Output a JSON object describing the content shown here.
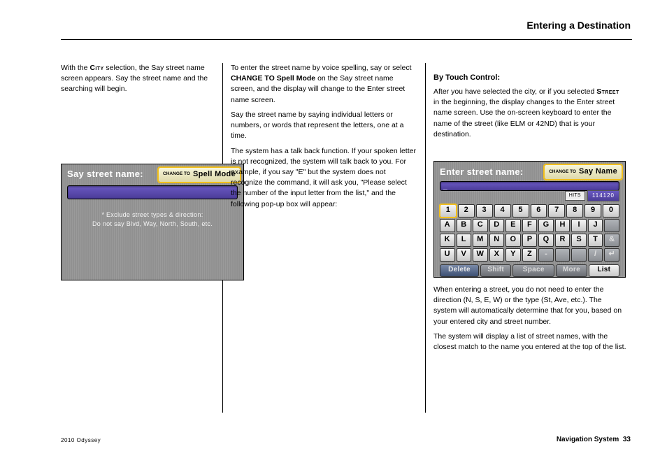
{
  "header": {
    "section_title": "Entering a Destination"
  },
  "col1": {
    "p1_a": "With the ",
    "p1_nav": "City",
    "p1_b": " selection, the Say street name screen appears. Say the street name and the searching will begin."
  },
  "screen1": {
    "title": "Say street name:",
    "change_pre": "CHANGE\nTO",
    "change_label": "Spell Mode",
    "helper1": "* Exclude street types & direction:",
    "helper2": "Do not say Blvd, Way, North, South, etc."
  },
  "col2": {
    "p1": "To enter the street name by voice spelling, say or select ",
    "p1_btn": "CHANGE TO Spell Mode",
    "p1_b": " on the Say street name screen, and the display will change to the Enter street name screen.",
    "p2": "Say the street name by saying individual letters or numbers, or words that represent the letters, one at a time.",
    "p3": "The system has a talk back function. If your spoken letter is not recognized, the system will talk back to you. For example, if you say \"E\" but the system does not recognize the command, it will ask you, \"Please select the number of the input letter from the list,\" and the following pop-up box will appear:"
  },
  "col3": {
    "heading": "By Touch Control:",
    "p1": "After you have selected the city, or if you selected ",
    "p1_nav": "Street",
    "p1_b": " in the beginning, the display changes to the Enter street name screen. Use the on-screen keyboard to enter the name of the street (like ELM or 42ND) that is your destination."
  },
  "screen2": {
    "title": "Enter street name:",
    "change_pre": "CHANGE\nTO",
    "change_label": "Say Name",
    "cursor": "_",
    "hits_label": "HITS",
    "hits_value": "114120",
    "rows": {
      "r1": [
        "1",
        "2",
        "3",
        "4",
        "5",
        "6",
        "7",
        "8",
        "9",
        "0"
      ],
      "r2": [
        "A",
        "B",
        "C",
        "D",
        "E",
        "F",
        "G",
        "H",
        "I",
        "J",
        ""
      ],
      "r3": [
        "K",
        "L",
        "M",
        "N",
        "O",
        "P",
        "Q",
        "R",
        "S",
        "T",
        "&"
      ],
      "r4": [
        "U",
        "V",
        "W",
        "X",
        "Y",
        "Z",
        "-",
        "",
        "",
        "/",
        "↵"
      ]
    },
    "bottom": {
      "delete": "Delete",
      "shift": "Shift",
      "space": "Space",
      "more": "More",
      "list": "List"
    }
  },
  "col3_after": {
    "p1": "When entering a street, you do not need to enter the direction (N, S, E, W) or the type (St, Ave, etc.). The system will automatically determine that for you, based on your entered city and street number.",
    "p2": "The system will display a list of street names, with the closest match to the name you entered at the top of the list."
  },
  "footer": {
    "left": "2010 Odyssey",
    "mid_a": "Navigation System",
    "mid_b": "33"
  }
}
